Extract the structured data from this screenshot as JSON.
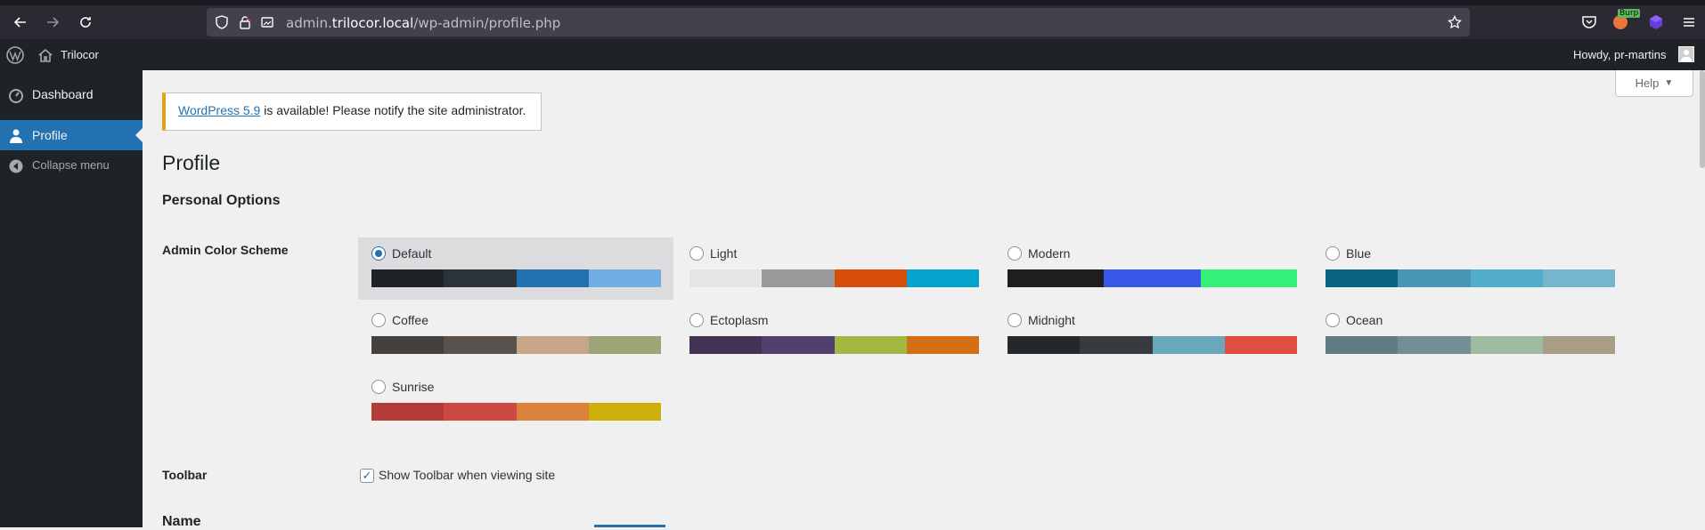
{
  "browser": {
    "url_prefix": "admin.",
    "url_host": "trilocor.local",
    "url_path": "/wp-admin/profile.php",
    "ext_badge": "Burp"
  },
  "adminbar": {
    "site_name": "Trilocor",
    "howdy": "Howdy, pr-martins"
  },
  "sidebar": {
    "items": [
      {
        "label": "Dashboard",
        "icon": "dashboard-icon"
      },
      {
        "label": "Profile",
        "icon": "user-icon",
        "current": true
      },
      {
        "label": "Collapse menu",
        "icon": "collapse-icon"
      }
    ]
  },
  "main": {
    "help_label": "Help",
    "notice": {
      "link_text": "WordPress 5.9",
      "rest_text": " is available! Please notify the site administrator."
    },
    "page_title": "Profile",
    "section_title": "Personal Options",
    "color_scheme_label": "Admin Color Scheme",
    "schemes": [
      {
        "name": "Default",
        "selected": true,
        "colors": [
          "#1d2327",
          "#2c3338",
          "#2271b1",
          "#72aee6"
        ]
      },
      {
        "name": "Light",
        "selected": false,
        "colors": [
          "#e5e5e5",
          "#999999",
          "#d64e07",
          "#04a4cc"
        ]
      },
      {
        "name": "Modern",
        "selected": false,
        "colors": [
          "#1e1e1e",
          "#3858e9",
          "#33f078"
        ]
      },
      {
        "name": "Blue",
        "selected": false,
        "colors": [
          "#096484",
          "#4796b3",
          "#52accc",
          "#74b6ce"
        ]
      },
      {
        "name": "Coffee",
        "selected": false,
        "colors": [
          "#46403c",
          "#59524c",
          "#c7a589",
          "#9ea476"
        ]
      },
      {
        "name": "Ectoplasm",
        "selected": false,
        "colors": [
          "#413256",
          "#523f6d",
          "#a3b745",
          "#d46f15"
        ]
      },
      {
        "name": "Midnight",
        "selected": false,
        "colors": [
          "#25282b",
          "#363b3f",
          "#69a8bb",
          "#e14d43"
        ]
      },
      {
        "name": "Ocean",
        "selected": false,
        "colors": [
          "#627c83",
          "#738e96",
          "#9ebaa0",
          "#aa9d88"
        ]
      },
      {
        "name": "Sunrise",
        "selected": false,
        "colors": [
          "#b43c38",
          "#cf4944",
          "#dd823b",
          "#ccaf0b"
        ]
      }
    ],
    "toolbar_label": "Toolbar",
    "toolbar_checkbox_label": "Show Toolbar when viewing site",
    "toolbar_checked": true,
    "name_label": "Name"
  }
}
